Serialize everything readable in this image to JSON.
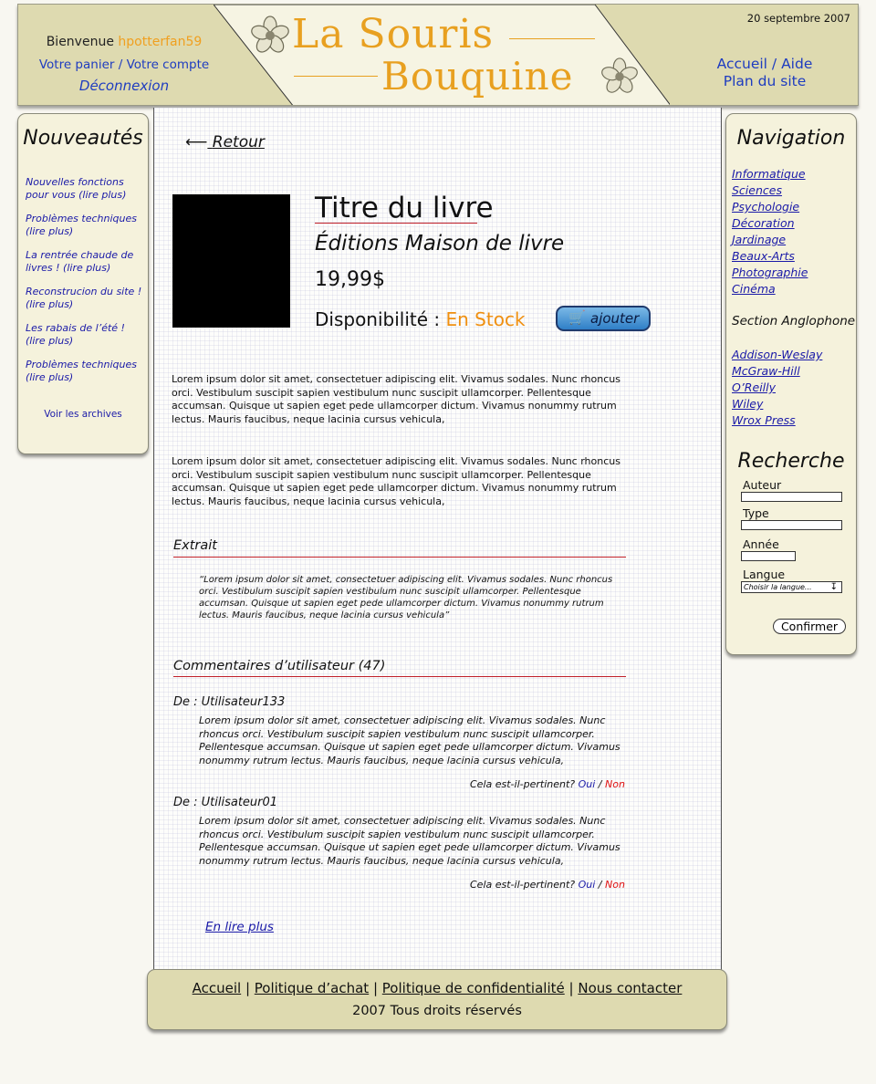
{
  "header": {
    "welcome_text": "Bienvenue",
    "username": "hpotterfan59",
    "cart_link": "Votre panier",
    "account_link": "Votre compte",
    "logout_link": "Déconnexion",
    "logo_line1": "La Souris",
    "logo_line2": "Bouquine",
    "date": "20 septembre 2007",
    "home_link": "Accueil",
    "help_link": "Aide",
    "sitemap_link": "Plan du site"
  },
  "news": {
    "title": "Nouveautés",
    "items": [
      "Nouvelles fonctions pour vous (lire plus)",
      "Problèmes techniques (lire plus)",
      "La rentrée chaude de livres ! (lire plus)",
      "Reconstrucion du site ! (lire plus)",
      "Les rabais de l’été ! (lire plus)",
      "Problèmes techniques (lire plus)"
    ],
    "archives_link": "Voir les archives"
  },
  "navigation": {
    "title": "Navigation",
    "categories": [
      "Informatique",
      "Sciences",
      "Psychologie",
      "Décoration",
      "Jardinage",
      "Beaux-Arts",
      "Photographie",
      "Cinéma"
    ],
    "english_section_label": "Section Anglophone",
    "publishers": [
      "Addison-Weslay",
      "McGraw-Hill",
      "O’Reilly",
      "Wiley",
      "Wrox Press"
    ]
  },
  "search": {
    "title": "Recherche",
    "author_label": "Auteur",
    "type_label": "Type",
    "year_label": "Année",
    "language_label": "Langue",
    "language_selected": "Choisir la langue...",
    "submit_label": "Confirmer"
  },
  "book": {
    "back_label": "Retour",
    "title": "Titre du livre",
    "publisher": "Éditions Maison de livre",
    "price": "19,99$",
    "availability_label": "Disponibilité :",
    "availability_value": "En Stock",
    "add_label": "ajouter",
    "description_1": "Lorem ipsum dolor sit amet, consectetuer adipiscing elit. Vivamus sodales. Nunc rhoncus orci. Vestibulum suscipit sapien vestibulum nunc suscipit ullamcorper. Pellentesque accumsan. Quisque ut sapien eget pede ullamcorper dictum. Vivamus nonummy rutrum lectus. Mauris faucibus, neque lacinia cursus vehicula,",
    "description_2": "Lorem ipsum dolor sit amet, consectetuer adipiscing elit. Vivamus sodales. Nunc rhoncus orci. Vestibulum suscipit sapien vestibulum nunc suscipit ullamcorper. Pellentesque accumsan. Quisque ut sapien eget pede ullamcorper dictum. Vivamus nonummy rutrum lectus. Mauris faucibus, neque lacinia cursus vehicula,"
  },
  "excerpt": {
    "heading": "Extrait",
    "text": "“Lorem ipsum dolor sit amet, consectetuer adipiscing elit. Vivamus sodales. Nunc rhoncus orci. Vestibulum suscipit sapien vestibulum nunc suscipit ullamcorper. Pellentesque accumsan. Quisque ut sapien eget pede ullamcorper dictum. Vivamus nonummy rutrum lectus. Mauris faucibus, neque lacinia cursus vehicula”"
  },
  "comments": {
    "heading": "Commentaires d’utilisateur (47)",
    "items": [
      {
        "from": "De : Utilisateur133",
        "text": "Lorem ipsum dolor sit amet, consectetuer adipiscing elit. Vivamus sodales. Nunc rhoncus orci. Vestibulum suscipit sapien vestibulum nunc suscipit ullamcorper. Pellentesque accumsan. Quisque ut sapien eget pede ullamcorper dictum. Vivamus nonummy rutrum lectus. Mauris faucibus, neque lacinia cursus vehicula,",
        "question": "Cela est-il-pertinent?",
        "yes": "Oui",
        "no": "Non"
      },
      {
        "from": "De : Utilisateur01",
        "text": "Lorem ipsum dolor sit amet, consectetuer adipiscing elit. Vivamus sodales. Nunc rhoncus orci. Vestibulum suscipit sapien vestibulum nunc suscipit ullamcorper. Pellentesque accumsan. Quisque ut sapien eget pede ullamcorper dictum. Vivamus nonummy rutrum lectus. Mauris faucibus, neque lacinia cursus vehicula,",
        "question": "Cela est-il-pertinent?",
        "yes": "Oui",
        "no": "Non"
      }
    ],
    "more_link": "En lire plus"
  },
  "footer": {
    "home": "Accueil",
    "purchase_policy": "Politique d’achat",
    "privacy_policy": "Politique de confidentialité",
    "contact": "Nous contacter",
    "copyright": "2007 Tous droits réservés"
  },
  "icons": {
    "flower": "flower-ornament-icon",
    "back": "left-arrow-icon",
    "cart": "cart-icon",
    "dropdown": "down-arrow-icon"
  },
  "colors": {
    "header_bg": "#dedab0",
    "panel_bg": "#f5f2dc",
    "logo_gold": "#e8a020",
    "link_blue": "#1a1aa8",
    "accent_red": "#c0202a",
    "stock_orange": "#f09010"
  }
}
